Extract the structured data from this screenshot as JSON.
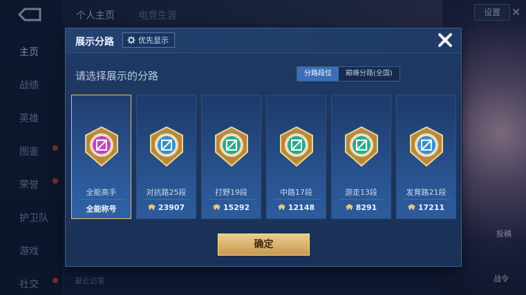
{
  "background": {
    "top_tabs": [
      "个人主页",
      "电竞生涯"
    ],
    "top_right_button": "设置",
    "sidenav": [
      {
        "label": "主页",
        "active": true,
        "dot": false
      },
      {
        "label": "战绩",
        "active": false,
        "dot": false
      },
      {
        "label": "英雄",
        "active": false,
        "dot": false
      },
      {
        "label": "图鉴",
        "active": false,
        "dot": true
      },
      {
        "label": "荣誉",
        "active": false,
        "dot": true
      },
      {
        "label": "护卫队",
        "active": false,
        "dot": false
      },
      {
        "label": "游戏",
        "active": false,
        "dot": false
      },
      {
        "label": "社交",
        "active": false,
        "dot": true
      }
    ],
    "bottom_hint": "最近访客",
    "side_label_1": "投稿",
    "side_label_2": "战令"
  },
  "modal": {
    "title": "展示分路",
    "priority_button": "优先显示",
    "subtitle": "请选择展示的分路",
    "segments": [
      {
        "label": "分路段位",
        "active": true
      },
      {
        "label": "巅峰分路(全国)",
        "active": false
      }
    ],
    "cards": [
      {
        "name": "全能高手",
        "footer": "全能称号",
        "show_score_icon": false,
        "selected": true,
        "emblem": "all-round-emblem-icon",
        "color": "#c43ad0"
      },
      {
        "name": "对抗路25段",
        "footer": "23907",
        "show_score_icon": true,
        "selected": false,
        "emblem": "clash-lane-emblem-icon",
        "color": "#2b8fe0"
      },
      {
        "name": "打野19段",
        "footer": "15292",
        "show_score_icon": true,
        "selected": false,
        "emblem": "jungle-emblem-icon",
        "color": "#1fae8a"
      },
      {
        "name": "中路17段",
        "footer": "12148",
        "show_score_icon": true,
        "selected": false,
        "emblem": "mid-lane-emblem-icon",
        "color": "#1fae8a"
      },
      {
        "name": "游走13段",
        "footer": "8291",
        "show_score_icon": true,
        "selected": false,
        "emblem": "roam-emblem-icon",
        "color": "#1fae8a"
      },
      {
        "name": "发育路21段",
        "footer": "17211",
        "show_score_icon": true,
        "selected": false,
        "emblem": "farm-lane-emblem-icon",
        "color": "#2b8fe0"
      }
    ],
    "confirm_label": "确定"
  },
  "colors": {
    "accent_blue": "#3a6fb8",
    "gold": "#e4c27a",
    "panel": "#1f3a66"
  }
}
